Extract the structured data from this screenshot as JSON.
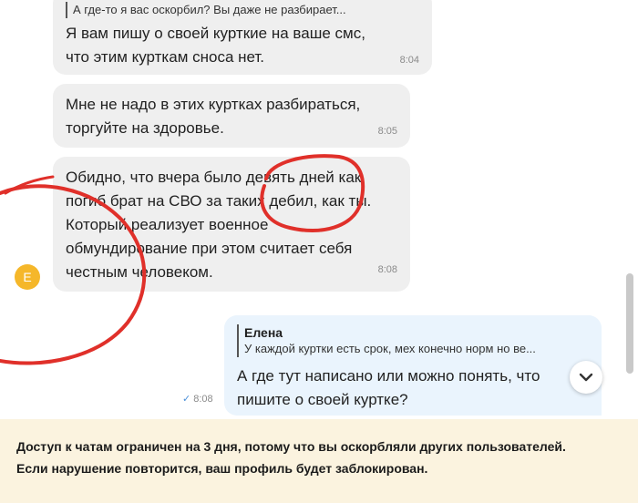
{
  "messages": [
    {
      "quote_text": "А где-то я вас оскорбил? Вы даже не разбирает...",
      "lines": [
        "Я вам пишу о своей курткие на ваше смс,",
        "что этим курткам сноса нет."
      ],
      "time": "8:04"
    },
    {
      "lines": [
        "Мне не надо в этих куртках разбираться,",
        "торгуйте на здоровье."
      ],
      "time": "8:05"
    },
    {
      "lines": [
        "Обидно, что вчера было девять дней как",
        "погиб брат на СВО за таких дебил, как ты.",
        "Который реализует военное",
        "обмундирование при этом считает себя",
        "честным человеком."
      ],
      "time": "8:08",
      "avatar_letter": "Е"
    }
  ],
  "sent_message": {
    "quote_author": "Елена",
    "quote_text": "У каждой куртки есть срок, мех конечно норм но ве...",
    "lines": [
      "А где тут написано или можно понять, что",
      "пишите о своей куртке?"
    ],
    "time": "8:08"
  },
  "colors": {
    "incoming_bubble": "#efefef",
    "outgoing_bubble": "#eaf4fd",
    "avatar": "#f5b72a",
    "annotation_ink": "#e0302a",
    "banner": "#fbf3df"
  },
  "scroll_down_icon": "chevron-down-icon",
  "banner": {
    "line1": "Доступ к чатам ограничен на 3 дня, потому что вы оскорбляли других пользователей.",
    "line2": "Если нарушение повторится, ваш профиль будет заблокирован."
  }
}
